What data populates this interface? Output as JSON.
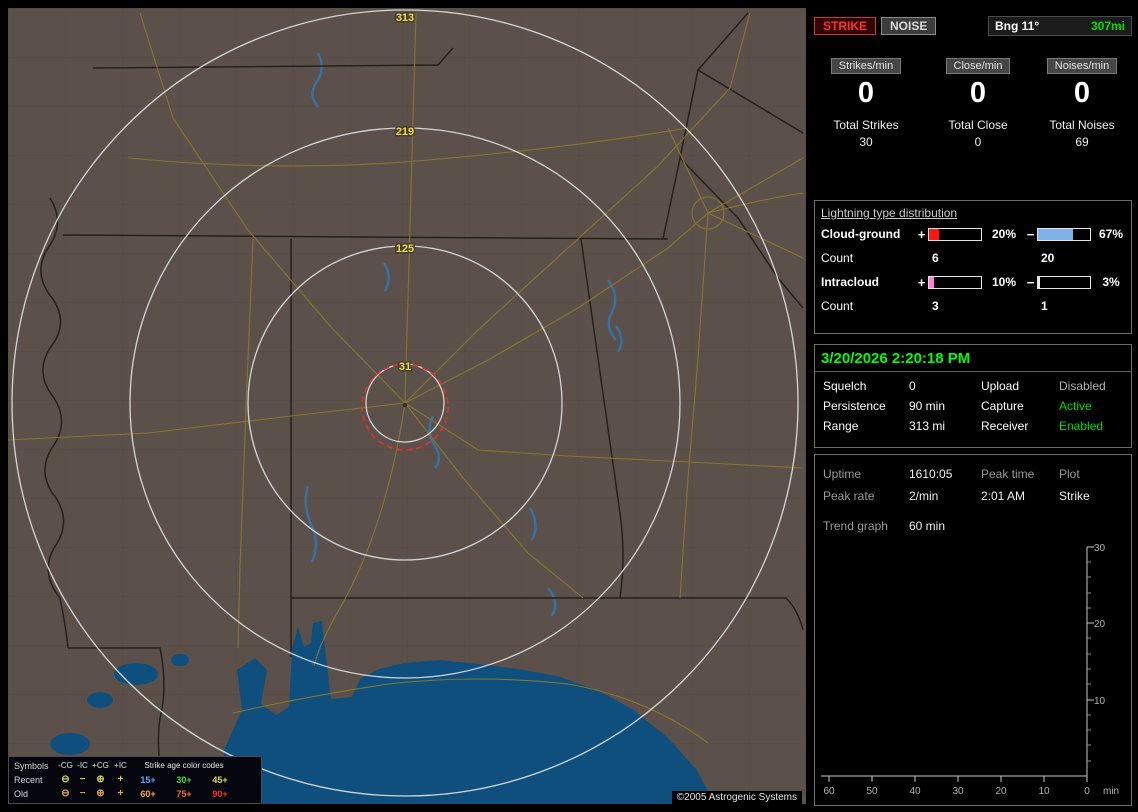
{
  "header": {
    "strike": "STRIKE",
    "noise": "NOISE",
    "bearing": "Bng 11°",
    "range": "307mi",
    "strike_color": "#ff3232",
    "range_color": "#00e000"
  },
  "rates": {
    "columns": [
      {
        "header": "Strikes/min",
        "rate": "0",
        "total_label": "Total Strikes",
        "total": "30"
      },
      {
        "header": "Close/min",
        "rate": "0",
        "total_label": "Total Close",
        "total": "0"
      },
      {
        "header": "Noises/min",
        "rate": "0",
        "total_label": "Total Noises",
        "total": "69"
      }
    ]
  },
  "distribution": {
    "title": "Lightning type distribution",
    "rows": [
      {
        "label": "Cloud-ground",
        "plus_sign": "+",
        "plus_pct": "20%",
        "plus_fill": 20,
        "plus_color": "#ff1414",
        "minus_sign": "−",
        "minus_pct": "67%",
        "minus_fill": 67,
        "minus_color": "#7fb2e8",
        "count_label": "Count",
        "plus_count": "6",
        "minus_count": "20"
      },
      {
        "label": "Intracloud",
        "plus_sign": "+",
        "plus_pct": "10%",
        "plus_fill": 10,
        "plus_color": "#ff80d5",
        "minus_sign": "−",
        "minus_pct": "3%",
        "minus_fill": 3,
        "minus_color": "#e8e8e8",
        "count_label": "Count",
        "plus_count": "3",
        "minus_count": "1"
      }
    ]
  },
  "status": {
    "datetime": "3/20/2026 2:20:18 PM",
    "datetime_color": "#00ff00",
    "rows": [
      {
        "key1": "Squelch",
        "val1": "0",
        "key2": "Upload",
        "val2": "Disabled",
        "val2_color": "#b4b4b4"
      },
      {
        "key1": "Persistence",
        "val1": "90 min",
        "key2": "Capture",
        "val2": "Active",
        "val2_color": "#00dd00"
      },
      {
        "key1": "Range",
        "val1": "313 mi",
        "key2": "Receiver",
        "val2": "Enabled",
        "val2_color": "#00dd00"
      }
    ]
  },
  "trend": {
    "uptime_label": "Uptime",
    "uptime_value": "1610:05",
    "peak_time_label": "Peak time",
    "plot_label": "Plot",
    "peak_rate_label": "Peak rate",
    "peak_rate_value": "2/min",
    "peak_time_value": "2:01 AM",
    "plot_value": "Strike",
    "graph_label": "Trend graph",
    "graph_window": "60 min"
  },
  "chart_data": {
    "type": "line",
    "title": "Trend graph (60 min)",
    "x_ticks": [
      "60",
      "50",
      "40",
      "30",
      "20",
      "10",
      "0"
    ],
    "x_unit": "min",
    "y_ticks": [
      "30",
      "20",
      "10"
    ],
    "ylim": [
      0,
      30
    ],
    "xlim_minutes_ago": [
      60,
      0
    ],
    "series": [],
    "note": "no strikes plotted in trend window"
  },
  "map": {
    "credit": "©2005 Astrogenic Systems",
    "ring_label_color": "#f0dd45",
    "rings": [
      {
        "label": "313"
      },
      {
        "label": "219"
      },
      {
        "label": "125"
      },
      {
        "label": "31"
      }
    ],
    "legend": {
      "symbols_header": "Symbols",
      "symbol_cols": [
        "-CG",
        "-IC",
        "+CG",
        "+IC"
      ],
      "age_header": "Strike age color codes",
      "rows": [
        {
          "label": "Recent",
          "symbols": [
            "⊖",
            "−",
            "⊕",
            "+"
          ],
          "symbol_color": "#cfd058",
          "ages": [
            {
              "text": "15+",
              "color": "#55aaff"
            },
            {
              "text": "30+",
              "color": "#44dd44"
            },
            {
              "text": "45+",
              "color": "#dddd44"
            }
          ]
        },
        {
          "label": "Old",
          "symbols": [
            "⊖",
            "−",
            "⊕",
            "+"
          ],
          "symbol_color": "#d8a84a",
          "ages": [
            {
              "text": "60+",
              "color": "#ffaa33"
            },
            {
              "text": "75+",
              "color": "#ff6633"
            },
            {
              "text": "90+",
              "color": "#ff3030"
            }
          ]
        }
      ]
    }
  }
}
